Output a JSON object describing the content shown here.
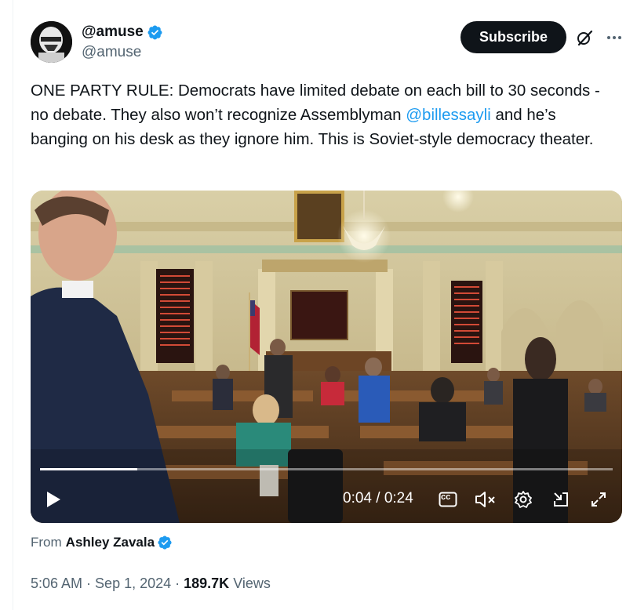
{
  "author": {
    "display_name": "@amuse",
    "handle": "@amuse",
    "avatar_icon": "stormtrooper-avatar",
    "verified_color": "#1d9bf0"
  },
  "actions": {
    "subscribe_label": "Subscribe",
    "grok_icon": "grok-slash-icon",
    "more_icon": "ellipsis-icon"
  },
  "tweet": {
    "text_part1": "ONE PARTY RULE: Democrats have limited debate on each bill to 30 seconds - no debate. They also won’t recognize Assemblyman ",
    "mention": "@billessayli",
    "text_part2": " and he’s banging on his desk as they ignore him. This is Soviet-style democracy theater."
  },
  "video": {
    "time_display": "0:04 / 0:24",
    "progress_fraction": 0.17,
    "controls": [
      "play-icon",
      "captions-icon",
      "mute-icon",
      "settings-icon",
      "pop-out-icon",
      "fullscreen-icon"
    ],
    "captions_label": "cc"
  },
  "source": {
    "prefix": "From",
    "name": "Ashley Zavala"
  },
  "meta": {
    "time": "5:06 AM",
    "date": "Sep 1, 2024",
    "views_count": "189.7K",
    "views_label": "Views",
    "separator": "·"
  },
  "colors": {
    "link": "#1d9bf0",
    "text": "#0f1419",
    "secondary": "#536471"
  }
}
